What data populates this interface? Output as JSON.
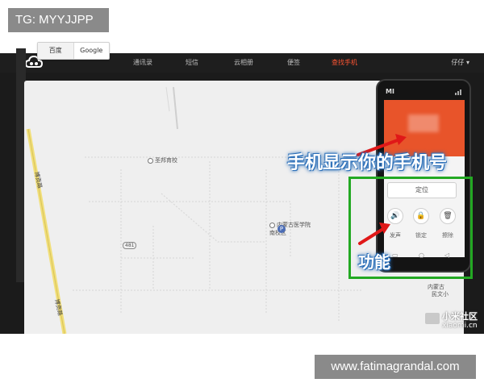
{
  "overlay": {
    "top_label": "TG: MYYJJPP",
    "bottom_label": "www.fatimagrandal.com"
  },
  "nav": {
    "items": [
      "通讯录",
      "短信",
      "云相册",
      "便签",
      "查找手机"
    ],
    "active_index": 4,
    "user": "仔仔 ▾",
    "active_color": "#ff5533"
  },
  "map": {
    "switch": [
      "百度",
      "Google"
    ],
    "pois": [
      "圣邦育校",
      "内蒙古医学院南校区",
      "内蒙古",
      "民文小"
    ],
    "roads": [
      "博贡路",
      "博贡路"
    ],
    "road_marker": "481",
    "parking": "P"
  },
  "phone": {
    "brand": "MI",
    "locate_label": "定位",
    "functions": [
      {
        "icon": "speaker-icon",
        "glyph": "🔊",
        "label": "发声"
      },
      {
        "icon": "lock-icon",
        "glyph": "🔒",
        "label": "锁定"
      },
      {
        "icon": "trash-icon",
        "glyph": "🗑",
        "label": "擦除"
      }
    ],
    "nav_glyphs": [
      "▭",
      "○",
      "◁"
    ]
  },
  "annotations": {
    "phone_number": "手机显示你的手机号",
    "functions": "功能",
    "box_color": "#23a923",
    "arrow_color": "#e01818"
  },
  "watermark": {
    "title": "小米社区",
    "sub": "xiaomi.cn"
  }
}
